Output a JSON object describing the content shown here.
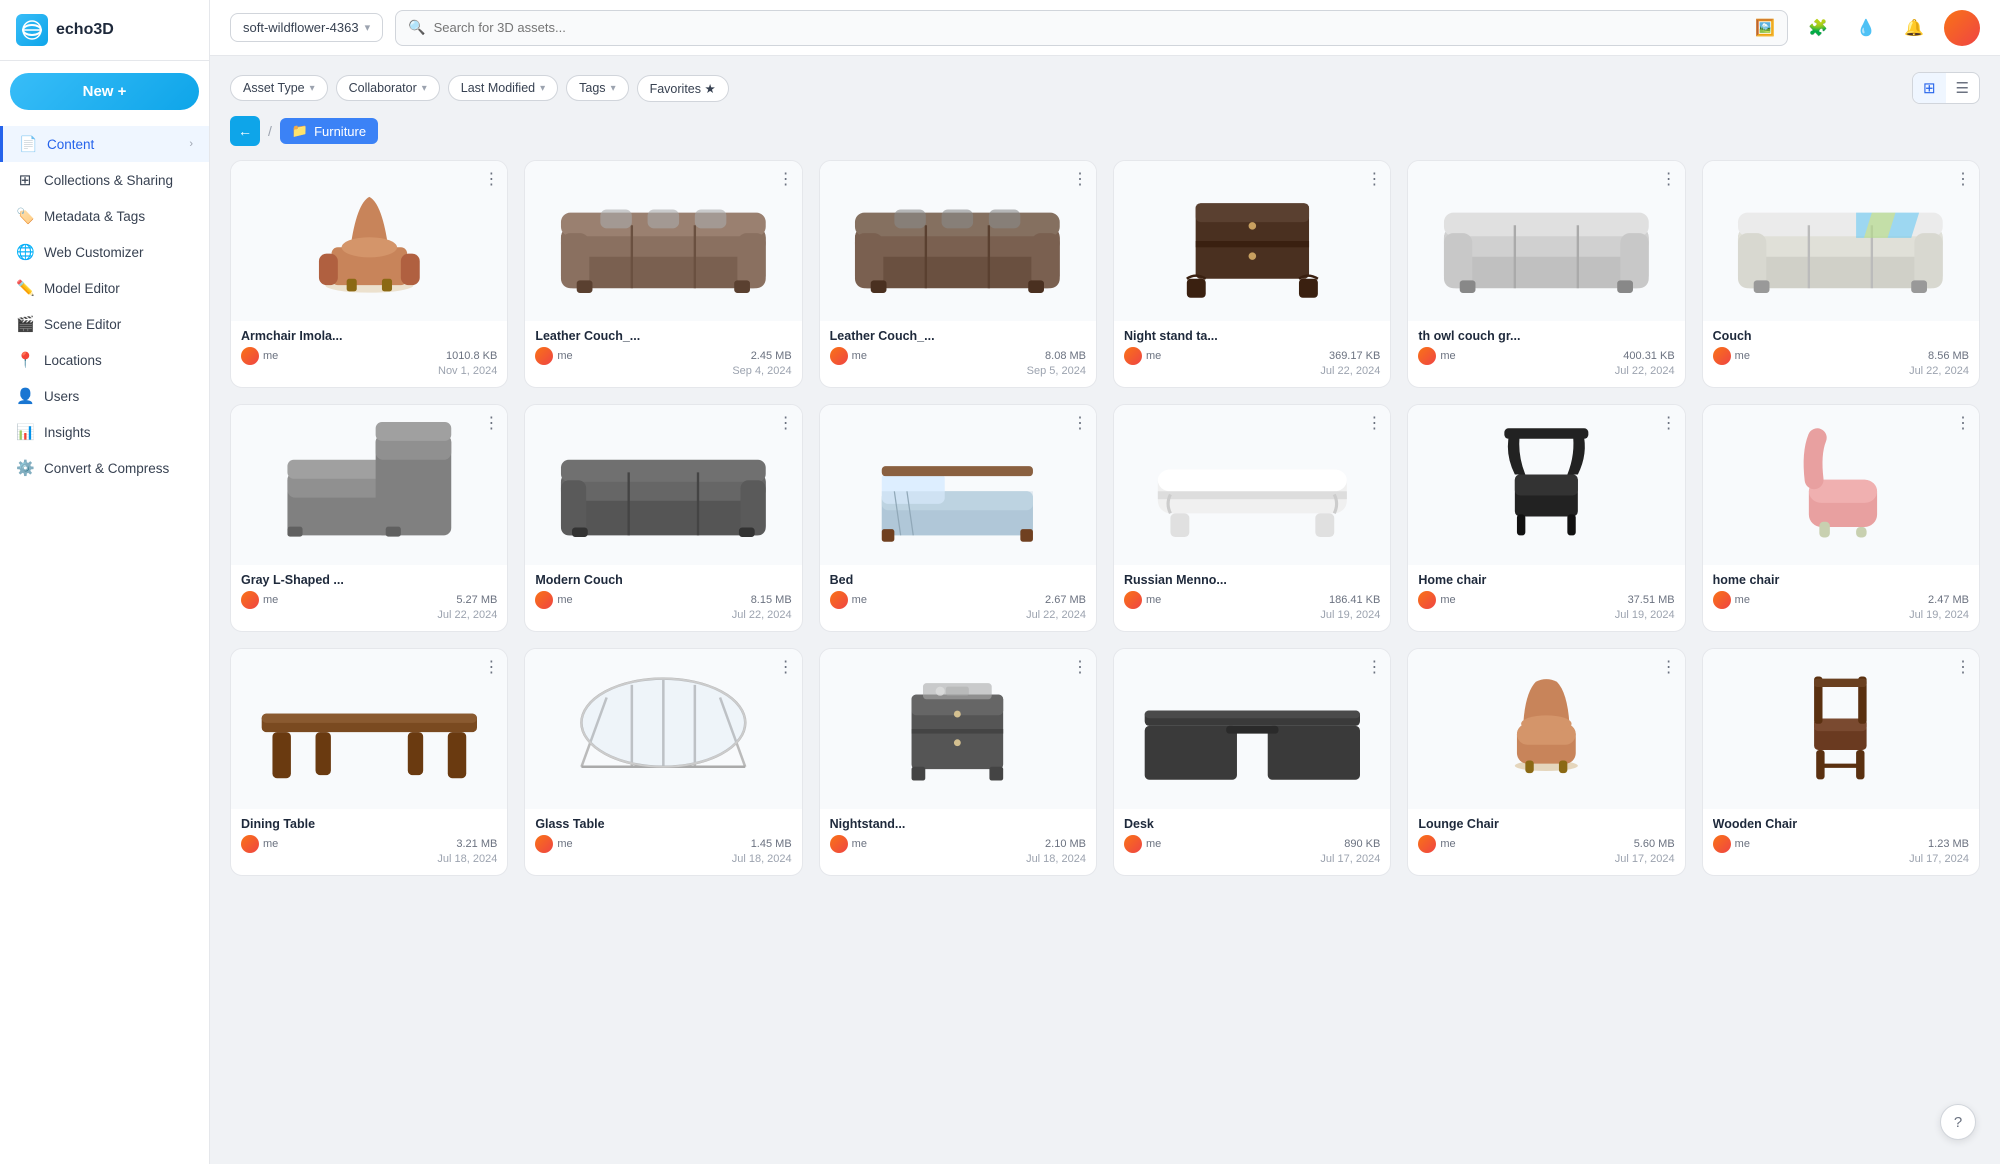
{
  "app": {
    "logo": "echo3D",
    "workspace": "soft-wildflower-4363"
  },
  "new_button": "New +",
  "nav": {
    "items": [
      {
        "id": "content",
        "label": "Content",
        "icon": "📄",
        "active": true,
        "has_arrow": true
      },
      {
        "id": "collections",
        "label": "Collections & Sharing",
        "icon": "⊞",
        "active": false
      },
      {
        "id": "metadata",
        "label": "Metadata & Tags",
        "icon": "🏷️",
        "active": false
      },
      {
        "id": "web-customizer",
        "label": "Web Customizer",
        "icon": "🌐",
        "active": false
      },
      {
        "id": "model-editor",
        "label": "Model Editor",
        "icon": "✏️",
        "active": false
      },
      {
        "id": "scene-editor",
        "label": "Scene Editor",
        "icon": "🎬",
        "active": false
      },
      {
        "id": "locations",
        "label": "Locations",
        "icon": "📍",
        "active": false
      },
      {
        "id": "users",
        "label": "Users",
        "icon": "👤",
        "active": false
      },
      {
        "id": "insights",
        "label": "Insights",
        "icon": "📊",
        "active": false
      },
      {
        "id": "convert",
        "label": "Convert & Compress",
        "icon": "⚙️",
        "active": false
      }
    ]
  },
  "search": {
    "placeholder": "Search for 3D assets..."
  },
  "filters": [
    {
      "id": "asset-type",
      "label": "Asset Type"
    },
    {
      "id": "collaborator",
      "label": "Collaborator"
    },
    {
      "id": "last-modified",
      "label": "Last Modified"
    },
    {
      "id": "tags",
      "label": "Tags"
    },
    {
      "id": "favorites",
      "label": "Favorites ★"
    }
  ],
  "breadcrumb": {
    "folder": "Furniture",
    "back_label": "←",
    "separator": "/"
  },
  "view_toggle": {
    "grid_label": "⊞",
    "list_label": "☰"
  },
  "assets": [
    {
      "id": 1,
      "name": "Armchair Imola...",
      "size": "1010.8 KB",
      "user": "me",
      "date": "Nov 1, 2024",
      "thumb_type": "armchair_brown"
    },
    {
      "id": 2,
      "name": "Leather Couch_...",
      "size": "2.45 MB",
      "user": "me",
      "date": "Sep 4, 2024",
      "thumb_type": "leather_couch_brown"
    },
    {
      "id": 3,
      "name": "Leather Couch_...",
      "size": "8.08 MB",
      "user": "me",
      "date": "Sep 5, 2024",
      "thumb_type": "leather_couch_dark"
    },
    {
      "id": 4,
      "name": "Night stand ta...",
      "size": "369.17 KB",
      "user": "me",
      "date": "Jul 22, 2024",
      "thumb_type": "nightstand"
    },
    {
      "id": 5,
      "name": "th owl couch gr...",
      "size": "400.31 KB",
      "user": "me",
      "date": "Jul 22, 2024",
      "thumb_type": "gray_couch"
    },
    {
      "id": 6,
      "name": "Couch",
      "size": "8.56 MB",
      "user": "me",
      "date": "Jul 22, 2024",
      "thumb_type": "couch_striped"
    },
    {
      "id": 7,
      "name": "Gray L-Shaped ...",
      "size": "5.27 MB",
      "user": "me",
      "date": "Jul 22, 2024",
      "thumb_type": "gray_lshaped"
    },
    {
      "id": 8,
      "name": "Modern Couch",
      "size": "8.15 MB",
      "user": "me",
      "date": "Jul 22, 2024",
      "thumb_type": "modern_couch"
    },
    {
      "id": 9,
      "name": "Bed",
      "size": "2.67 MB",
      "user": "me",
      "date": "Jul 22, 2024",
      "thumb_type": "bed"
    },
    {
      "id": 10,
      "name": "Russian Menno...",
      "size": "186.41 KB",
      "user": "me",
      "date": "Jul 19, 2024",
      "thumb_type": "white_bench"
    },
    {
      "id": 11,
      "name": "Home chair",
      "size": "37.51 MB",
      "user": "me",
      "date": "Jul 19, 2024",
      "thumb_type": "black_chair"
    },
    {
      "id": 12,
      "name": "home chair",
      "size": "2.47 MB",
      "user": "me",
      "date": "Jul 19, 2024",
      "thumb_type": "pink_chair"
    },
    {
      "id": 13,
      "name": "Dining Table",
      "size": "3.21 MB",
      "user": "me",
      "date": "Jul 18, 2024",
      "thumb_type": "brown_table"
    },
    {
      "id": 14,
      "name": "Glass Table",
      "size": "1.45 MB",
      "user": "me",
      "date": "Jul 18, 2024",
      "thumb_type": "glass_table"
    },
    {
      "id": 15,
      "name": "Nightstand...",
      "size": "2.10 MB",
      "user": "me",
      "date": "Jul 18, 2024",
      "thumb_type": "nightstand2"
    },
    {
      "id": 16,
      "name": "Desk",
      "size": "890 KB",
      "user": "me",
      "date": "Jul 17, 2024",
      "thumb_type": "black_desk"
    },
    {
      "id": 17,
      "name": "Lounge Chair",
      "size": "5.60 MB",
      "user": "me",
      "date": "Jul 17, 2024",
      "thumb_type": "lounge_chair"
    },
    {
      "id": 18,
      "name": "Wooden Chair",
      "size": "1.23 MB",
      "user": "me",
      "date": "Jul 17, 2024",
      "thumb_type": "wooden_chair"
    }
  ],
  "help_label": "?"
}
